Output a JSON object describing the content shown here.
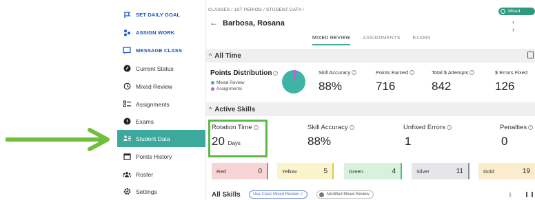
{
  "sidebar": {
    "items": [
      {
        "label": "SET DAILY GOAL",
        "icon": "flag-icon"
      },
      {
        "label": "ASSIGN WORK",
        "icon": "people-icon"
      },
      {
        "label": "MESSAGE CLASS",
        "icon": "message-icon"
      },
      {
        "label": "Current Status",
        "icon": "status-icon"
      },
      {
        "label": "Mixed Review",
        "icon": "history-icon"
      },
      {
        "label": "Assignments",
        "icon": "list-icon"
      },
      {
        "label": "Exams",
        "icon": "exam-icon"
      },
      {
        "label": "Student Data",
        "icon": "data-icon"
      },
      {
        "label": "Points History",
        "icon": "calendar-icon"
      },
      {
        "label": "Roster",
        "icon": "roster-icon"
      },
      {
        "label": "Settings",
        "icon": "gear-icon"
      }
    ],
    "active_index": 7
  },
  "header": {
    "breadcrumb": "CLASSES  /  1ST PERIOD  /  STUDENT DATA  /",
    "mode_pill": "Mixed Review",
    "back_arrow": "←",
    "student_name": "Barbosa, Rosana",
    "nav_arrows": "‹ ›",
    "tabs": [
      "MIXED REVIEW",
      "ASSIGNMENTS",
      "EXAMS"
    ],
    "selected_tab": 0
  },
  "all_time": {
    "title": "All Time",
    "points_distribution": {
      "title": "Points Distribution",
      "legend": [
        {
          "label": "Mixed Review",
          "color": "#3fb4a4"
        },
        {
          "label": "Assignments",
          "color": "#c15fd6"
        }
      ],
      "shares": [
        0.95,
        0.05
      ]
    },
    "stats": [
      {
        "label": "Skill Accuracy",
        "value": "88%"
      },
      {
        "label": "Points Earned",
        "value": "716"
      },
      {
        "label": "Total $ Attempts",
        "value": "842"
      },
      {
        "label": "$ Errors Fixed",
        "value": "126"
      }
    ]
  },
  "active_skills": {
    "title": "Active Skills",
    "stats": [
      {
        "label": "Rotation Time",
        "value": "20",
        "unit": "Days"
      },
      {
        "label": "Skill Accuracy",
        "value": "88%"
      },
      {
        "label": "Unfixed Errors",
        "value": "1"
      },
      {
        "label": "Penalties",
        "value": "0"
      }
    ],
    "badges": [
      {
        "label": "Red",
        "count": "0",
        "bg": "#f9d4d6",
        "edge": "#e07078"
      },
      {
        "label": "Yellow",
        "count": "5",
        "bg": "#fbf3c9",
        "edge": "#e2c84a"
      },
      {
        "label": "Green",
        "count": "4",
        "bg": "#d7f1dd",
        "edge": "#5cb870"
      },
      {
        "label": "Silver",
        "count": "11",
        "bg": "#e4e6ea",
        "edge": "#8b9099"
      },
      {
        "label": "Gold",
        "count": "19",
        "bg": "#fbeccb",
        "edge": "#d8a840"
      }
    ]
  },
  "all_skills": {
    "title": "All Skills",
    "chip_use_class": "Use Class Mixed Review ✓",
    "chip_modified": "Modified Mixed Review"
  },
  "colors": {
    "accent": "#3da89c",
    "highlight": "#5cb848"
  }
}
